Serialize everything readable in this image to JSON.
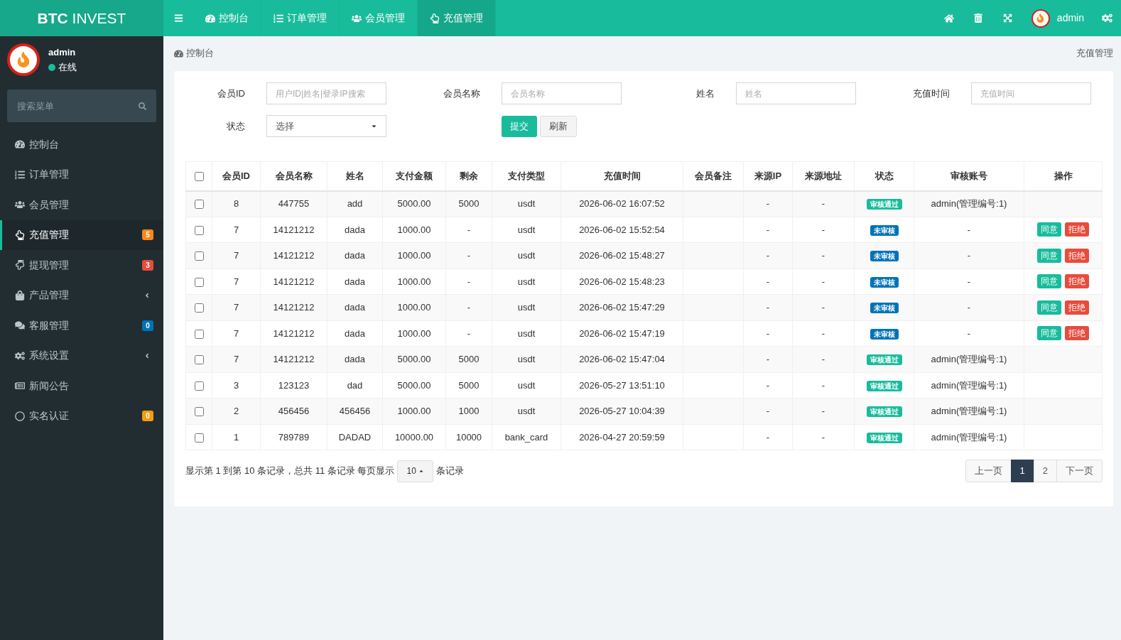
{
  "header": {
    "logo": "**BTC** INVEST",
    "nav_tabs": [
      {
        "label": "控制台",
        "selected": false
      },
      {
        "label": "订单管理",
        "selected": false
      },
      {
        "label": "会员管理",
        "selected": false
      },
      {
        "label": "充值管理",
        "selected": true
      }
    ],
    "user": "admin"
  },
  "sidebar": {
    "user": {
      "name": "admin",
      "status": "在线",
      "online": true
    },
    "search": {
      "placeholder": "搜索菜单"
    },
    "items": [
      {
        "label": "控制台",
        "kind": "link",
        "selected": false
      },
      {
        "label": "订单管理",
        "kind": "link",
        "selected": false
      },
      {
        "label": "会员管理",
        "kind": "link",
        "selected": false
      },
      {
        "label": "充值管理",
        "kind": "link",
        "selected": true,
        "badge": {
          "text": "5",
          "color": "#ff851b"
        }
      },
      {
        "label": "提现管理",
        "kind": "link",
        "selected": false,
        "badge": {
          "text": "3",
          "color": "#e74c3c"
        }
      },
      {
        "label": "产品管理",
        "kind": "treeview",
        "selected": false,
        "expanded": false
      },
      {
        "label": "客服管理",
        "kind": "link",
        "selected": false,
        "badge": {
          "text": "0",
          "color": "#0073b7"
        }
      },
      {
        "label": "系统设置",
        "kind": "treeview",
        "selected": false,
        "expanded": false
      },
      {
        "label": "新闻公告",
        "kind": "link",
        "selected": false
      },
      {
        "label": "实名认证",
        "kind": "link",
        "selected": false,
        "badge": {
          "text": "0",
          "color": "#f39c12"
        }
      }
    ]
  },
  "breadcrumb": {
    "home": "控制台",
    "current": "充值管理"
  },
  "filters": {
    "fields": [
      {
        "label": "会员ID",
        "placeholder": "用户ID|姓名|登录IP搜索"
      },
      {
        "label": "会员名称",
        "placeholder": "会员名称"
      },
      {
        "label": "姓名",
        "placeholder": "姓名"
      },
      {
        "label": "充值时间",
        "placeholder": "充值时间"
      }
    ],
    "status": {
      "label": "状态",
      "value": "选择"
    },
    "buttons": [
      {
        "label": "提交",
        "kind": "primary"
      },
      {
        "label": "刷新",
        "kind": "default"
      }
    ]
  },
  "table": {
    "select_all_checked": false,
    "columns": [
      "会员ID",
      "会员名称",
      "姓名",
      "支付金额",
      "剩余",
      "支付类型",
      "充值时间",
      "会员备注",
      "来源IP",
      "来源地址",
      "状态",
      "审核账号",
      "操作"
    ],
    "rows": [
      {
        "checked": false,
        "member_id": "8",
        "member_name": "447755",
        "name": "add",
        "amount": "5000.00",
        "remaining": "5000",
        "pay_type": "usdt",
        "time": "2026-06-02 16:07:52",
        "source_ip": "-",
        "source_address": "-",
        "status": {
          "text": "审核通过",
          "color": "#18bc9c"
        },
        "reviewer": "admin(管理编号:1)"
      },
      {
        "checked": false,
        "member_id": "7",
        "member_name": "14121212",
        "name": "dada",
        "amount": "1000.00",
        "remaining": "-",
        "pay_type": "usdt",
        "time": "2026-06-02 15:52:54",
        "source_ip": "-",
        "source_address": "-",
        "status": {
          "text": "未审核",
          "color": "#0073b7"
        },
        "reviewer": "-",
        "actions": [
          {
            "label": "同意",
            "kind": "approve"
          },
          {
            "label": "拒绝",
            "kind": "reject"
          }
        ]
      },
      {
        "checked": false,
        "member_id": "7",
        "member_name": "14121212",
        "name": "dada",
        "amount": "1000.00",
        "remaining": "-",
        "pay_type": "usdt",
        "time": "2026-06-02 15:48:27",
        "source_ip": "-",
        "source_address": "-",
        "status": {
          "text": "未审核",
          "color": "#0073b7"
        },
        "reviewer": "-",
        "actions": [
          {
            "label": "同意",
            "kind": "approve"
          },
          {
            "label": "拒绝",
            "kind": "reject"
          }
        ]
      },
      {
        "checked": false,
        "member_id": "7",
        "member_name": "14121212",
        "name": "dada",
        "amount": "1000.00",
        "remaining": "-",
        "pay_type": "usdt",
        "time": "2026-06-02 15:48:23",
        "source_ip": "-",
        "source_address": "-",
        "status": {
          "text": "未审核",
          "color": "#0073b7"
        },
        "reviewer": "-",
        "actions": [
          {
            "label": "同意",
            "kind": "approve"
          },
          {
            "label": "拒绝",
            "kind": "reject"
          }
        ]
      },
      {
        "checked": false,
        "member_id": "7",
        "member_name": "14121212",
        "name": "dada",
        "amount": "1000.00",
        "remaining": "-",
        "pay_type": "usdt",
        "time": "2026-06-02 15:47:29",
        "source_ip": "-",
        "source_address": "-",
        "status": {
          "text": "未审核",
          "color": "#0073b7"
        },
        "reviewer": "-",
        "actions": [
          {
            "label": "同意",
            "kind": "approve"
          },
          {
            "label": "拒绝",
            "kind": "reject"
          }
        ]
      },
      {
        "checked": false,
        "member_id": "7",
        "member_name": "14121212",
        "name": "dada",
        "amount": "1000.00",
        "remaining": "-",
        "pay_type": "usdt",
        "time": "2026-06-02 15:47:19",
        "source_ip": "-",
        "source_address": "-",
        "status": {
          "text": "未审核",
          "color": "#0073b7"
        },
        "reviewer": "-",
        "actions": [
          {
            "label": "同意",
            "kind": "approve"
          },
          {
            "label": "拒绝",
            "kind": "reject"
          }
        ]
      },
      {
        "checked": false,
        "member_id": "7",
        "member_name": "14121212",
        "name": "dada",
        "amount": "5000.00",
        "remaining": "5000",
        "pay_type": "usdt",
        "time": "2026-06-02 15:47:04",
        "source_ip": "-",
        "source_address": "-",
        "status": {
          "text": "审核通过",
          "color": "#18bc9c"
        },
        "reviewer": "admin(管理编号:1)"
      },
      {
        "checked": false,
        "member_id": "3",
        "member_name": "123123",
        "name": "dad",
        "amount": "5000.00",
        "remaining": "5000",
        "pay_type": "usdt",
        "time": "2026-05-27 13:51:10",
        "source_ip": "-",
        "source_address": "-",
        "status": {
          "text": "审核通过",
          "color": "#18bc9c"
        },
        "reviewer": "admin(管理编号:1)"
      },
      {
        "checked": false,
        "member_id": "2",
        "member_name": "456456",
        "name": "456456",
        "amount": "1000.00",
        "remaining": "1000",
        "pay_type": "usdt",
        "time": "2026-05-27 10:04:39",
        "source_ip": "-",
        "source_address": "-",
        "status": {
          "text": "审核通过",
          "color": "#18bc9c"
        },
        "reviewer": "admin(管理编号:1)"
      },
      {
        "checked": false,
        "member_id": "1",
        "member_name": "789789",
        "name": "DADAD",
        "amount": "10000.00",
        "remaining": "10000",
        "pay_type": "bank_card",
        "time": "2026-04-27 20:59:59",
        "source_ip": "-",
        "source_address": "-",
        "status": {
          "text": "审核通过",
          "color": "#18bc9c"
        },
        "reviewer": "admin(管理编号:1)"
      }
    ]
  },
  "pagination": {
    "summary": "显示第 1 到第 10 条记录，总共 11 条记录 每页显示",
    "page_size": "10",
    "suffix": "条记录",
    "pages": [
      {
        "label": "上一页",
        "selected": false
      },
      {
        "label": "1",
        "selected": true
      },
      {
        "label": "2",
        "selected": false
      },
      {
        "label": "下一页",
        "selected": false
      }
    ]
  }
}
